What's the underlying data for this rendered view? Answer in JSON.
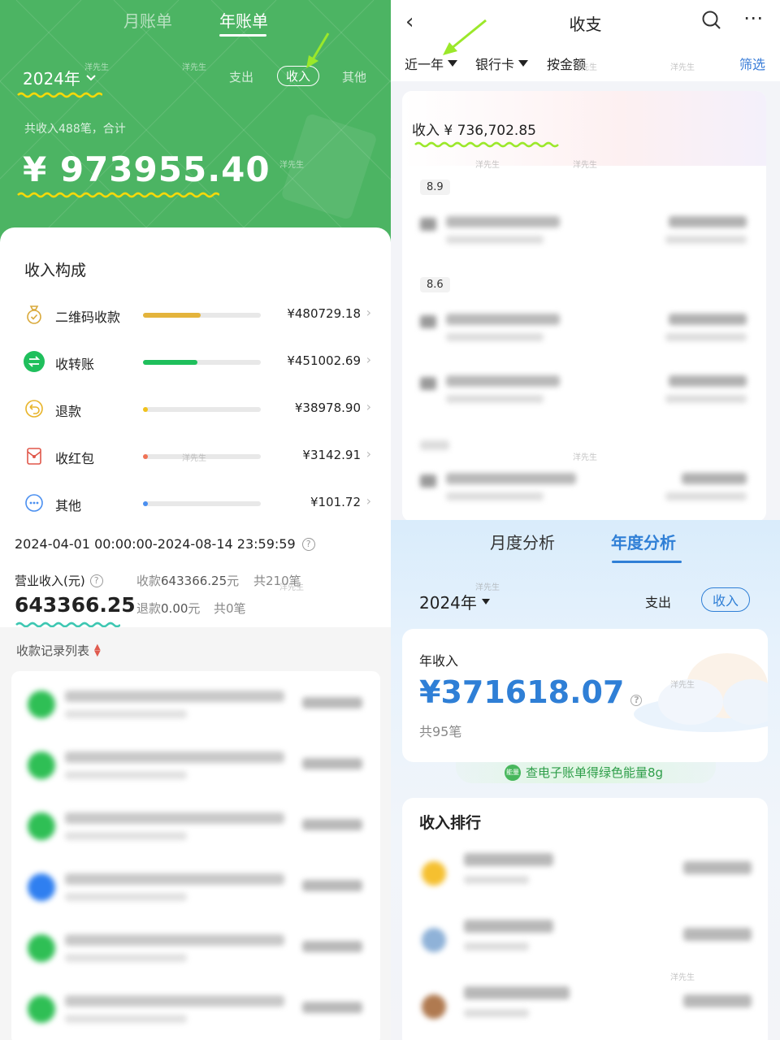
{
  "left": {
    "tabs": [
      "月账单",
      "年账单"
    ],
    "year": "2024年",
    "filters": [
      "支出",
      "收入",
      "其他"
    ],
    "summary": "共收入488笔，合计",
    "total": "¥ 973955.40",
    "section_title": "收入构成",
    "categories": [
      {
        "label": "二维码收款",
        "amount": "¥480729.18",
        "share": 0.49,
        "color": "#e4b43c"
      },
      {
        "label": "收转账",
        "amount": "¥451002.69",
        "share": 0.46,
        "color": "#1fbf5c"
      },
      {
        "label": "退款",
        "amount": "¥38978.90",
        "share": 0.04,
        "color": "#f1c21b"
      },
      {
        "label": "收红包",
        "amount": "¥3142.91",
        "share": 0.03,
        "color": "#f07356"
      },
      {
        "label": "其他",
        "amount": "¥101.72",
        "share": 0.02,
        "color": "#4a8ff0"
      }
    ],
    "date_range": "2024-04-01 00:00:00-2024-08-14 23:59:59",
    "biz_label": "营业收入(元)",
    "biz_amount": "643366.25",
    "stats": {
      "collect_label": "收款",
      "collect_amount": "643366.25",
      "collect_unit": "元",
      "collect_count_label": "共210笔",
      "refund_label": "退款",
      "refund_amount": "0.00",
      "refund_unit": "元",
      "refund_count_label": "共0笔"
    },
    "list_title": "收款记录列表"
  },
  "right": {
    "title": "收支",
    "filters": [
      "近一年",
      "银行卡",
      "按金额"
    ],
    "screen": "筛选",
    "income_total": "收入 ¥ 736,702.85",
    "dates": [
      "8.9",
      "8.6"
    ],
    "analysis_tabs": [
      "月度分析",
      "年度分析"
    ],
    "year": "2024年",
    "out_label": "支出",
    "in_label": "收入",
    "year_income_label": "年收入",
    "year_income": "¥371618.07",
    "year_count": "共95笔",
    "energy_text": "查电子账单得绿色能量8g",
    "rank_title": "收入排行"
  },
  "watermark": "洋先生",
  "colors": {
    "green": "#4cb463",
    "yellow": "#f5d90a",
    "blue": "#2f7fd6",
    "lime": "#9be82a"
  }
}
